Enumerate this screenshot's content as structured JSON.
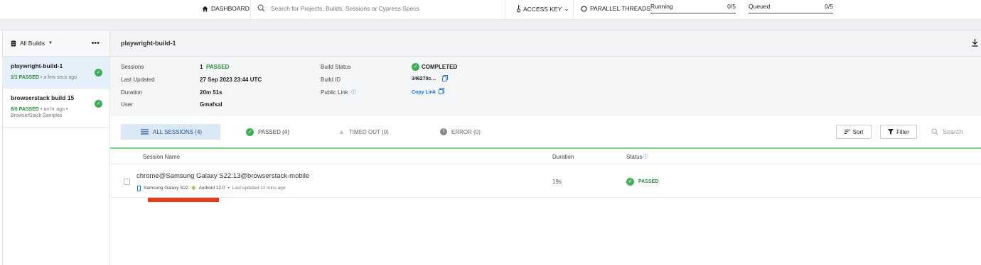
{
  "topbar": {
    "dashboard_label": "DASHBOARD",
    "search_placeholder": "Search for Projects, Builds, Sessions or Cypress Specs",
    "access_key_label": "ACCESS KEY",
    "parallel_label": "PARALLEL THREADS:",
    "running_label": "Running",
    "running_value": "0/5",
    "queued_label": "Queued",
    "queued_value": "0/5"
  },
  "sidebar": {
    "header_label": "All Builds",
    "more_label": "•••",
    "builds": [
      {
        "name": "playwright-build-1",
        "passed": "1/1 PASSED",
        "time": "a few secs ago",
        "project": ""
      },
      {
        "name": "browserstack build 15",
        "passed": "6/6 PASSED",
        "time": "an hr ago",
        "project": "BrowserStack Samples"
      }
    ]
  },
  "build": {
    "title": "playwright-build-1",
    "sessions_key": "Sessions",
    "sessions_count": "1",
    "sessions_status": "PASSED",
    "last_updated_key": "Last Updated",
    "last_updated_value": "27 Sep 2023 23:44 UTC",
    "duration_key": "Duration",
    "duration_value": "20m 51s",
    "user_key": "User",
    "user_value": "Gmafsal",
    "build_status_key": "Build Status",
    "build_status_value": "COMPLETED",
    "build_id_key": "Build ID",
    "build_id_value": "346270c…",
    "public_link_key": "Public Link",
    "copy_link_label": "Copy Link"
  },
  "tabs": {
    "all_sessions": "ALL SESSIONS (4)",
    "passed": "PASSED (4)",
    "timed_out": "TIMED OUT (0)",
    "error": "ERROR (0)",
    "sort_label": "Sort",
    "filter_label": "Filter",
    "search_placeholder": "Search"
  },
  "table": {
    "col_session_name": "Session Name",
    "col_duration": "Duration",
    "col_status": "Status",
    "rows": [
      {
        "name": "chrome@Samsung Galaxy S22:13@browserstack-mobile",
        "device": "Samsung Galaxy S22",
        "os": "Android 12.0",
        "updated": "Last updated 12 mins ago",
        "duration": "19s",
        "status": "PASSED"
      }
    ]
  },
  "colors": {
    "pass_green": "#2e8b3e",
    "active_tab_bg": "#dbe9f7",
    "highlight_red": "#e53a1e",
    "link_blue": "#1f6fd6"
  }
}
